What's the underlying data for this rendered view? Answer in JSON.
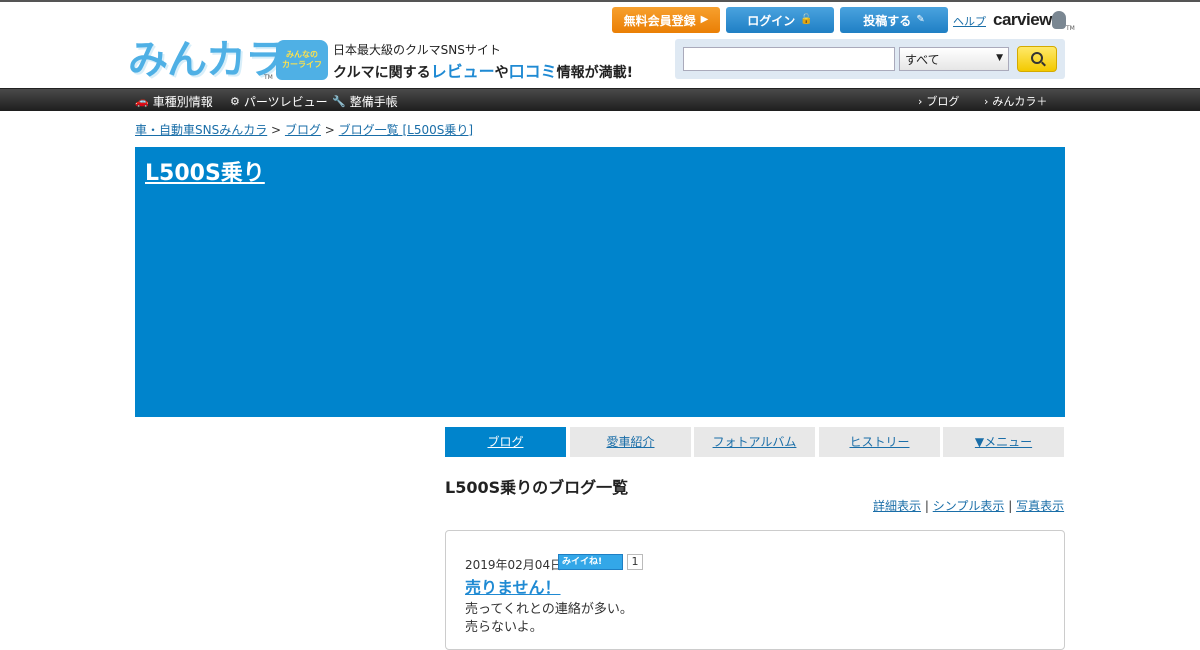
{
  "header": {
    "register_label": "無料会員登録",
    "login_label": "ログイン",
    "post_label": "投稿する",
    "help_label": "ヘルプ",
    "carview_logo": "carview",
    "carview_tm": "TM",
    "logo_text": "みんカラ",
    "logo_tm": "TM",
    "badge_line1": "みんなの",
    "badge_line2": "カーライフ",
    "tagline_top": "日本最大級のクルマSNSサイト",
    "tagline_a": "クルマに関する",
    "tagline_review": "レビュー",
    "tagline_b": "や",
    "tagline_kuchikomi": "口コミ",
    "tagline_c": "情報が満載!",
    "search": {
      "value": "",
      "select_value": "すべて"
    }
  },
  "nav": {
    "car_info": "車種別情報",
    "parts_review": "パーツレビュー",
    "maintenance": "整備手帳",
    "blog": "ブログ",
    "minkara_plus": "みんカラ＋"
  },
  "breadcrumb": {
    "item1": "車・自動車SNSみんカラ",
    "item2": "ブログ",
    "item3": "ブログ一覧 [L500S乗り]",
    "sep": ">"
  },
  "banner": {
    "title": "L500S乗り"
  },
  "tabs": [
    {
      "label": "ブログ"
    },
    {
      "label": "愛車紹介"
    },
    {
      "label": "フォトアルバム"
    },
    {
      "label": "ヒストリー"
    },
    {
      "label": "▼メニュー"
    }
  ],
  "main": {
    "list_title": "L500S乗りのブログ一覧",
    "view_detail": "詳細表示",
    "view_simple": "シンプル表示",
    "view_photo": "写真表示",
    "sep": "|"
  },
  "entry": {
    "date": "2019年02月04日",
    "iine_label": "みイイね!",
    "iine_count": "1",
    "title": "売りません！",
    "line1": "売ってくれとの連絡が多い。",
    "line2": "売らないよ。"
  },
  "colors": {
    "brand_blue": "#0084cc",
    "orange": "#ea7f05",
    "nav_bg": "#2a2a2a"
  }
}
